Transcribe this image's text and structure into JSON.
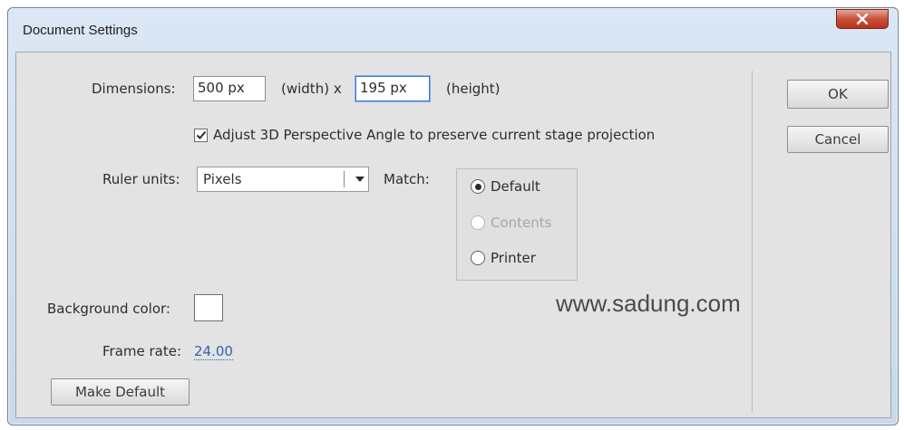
{
  "window": {
    "title": "Document Settings",
    "close_icon": "close-x-icon"
  },
  "dimensions": {
    "label": "Dimensions:",
    "width_value": "500 px",
    "width_suffix": "(width) x",
    "height_value": "195 px",
    "height_suffix": "(height)"
  },
  "perspective": {
    "checked": true,
    "label": "Adjust 3D Perspective Angle to preserve current stage projection"
  },
  "ruler": {
    "label": "Ruler units:",
    "selected": "Pixels",
    "arrow_icon": "dropdown-arrow-icon"
  },
  "match": {
    "label": "Match:",
    "options": [
      {
        "label": "Default",
        "selected": true,
        "disabled": false
      },
      {
        "label": "Contents",
        "selected": false,
        "disabled": true
      },
      {
        "label": "Printer",
        "selected": false,
        "disabled": false
      }
    ]
  },
  "background": {
    "label": "Background color:",
    "color": "#ffffff"
  },
  "frame_rate": {
    "label": "Frame rate:",
    "value": "24.00"
  },
  "watermark": "www.sadung.com",
  "buttons": {
    "ok": "OK",
    "cancel": "Cancel",
    "make_default": "Make Default"
  }
}
